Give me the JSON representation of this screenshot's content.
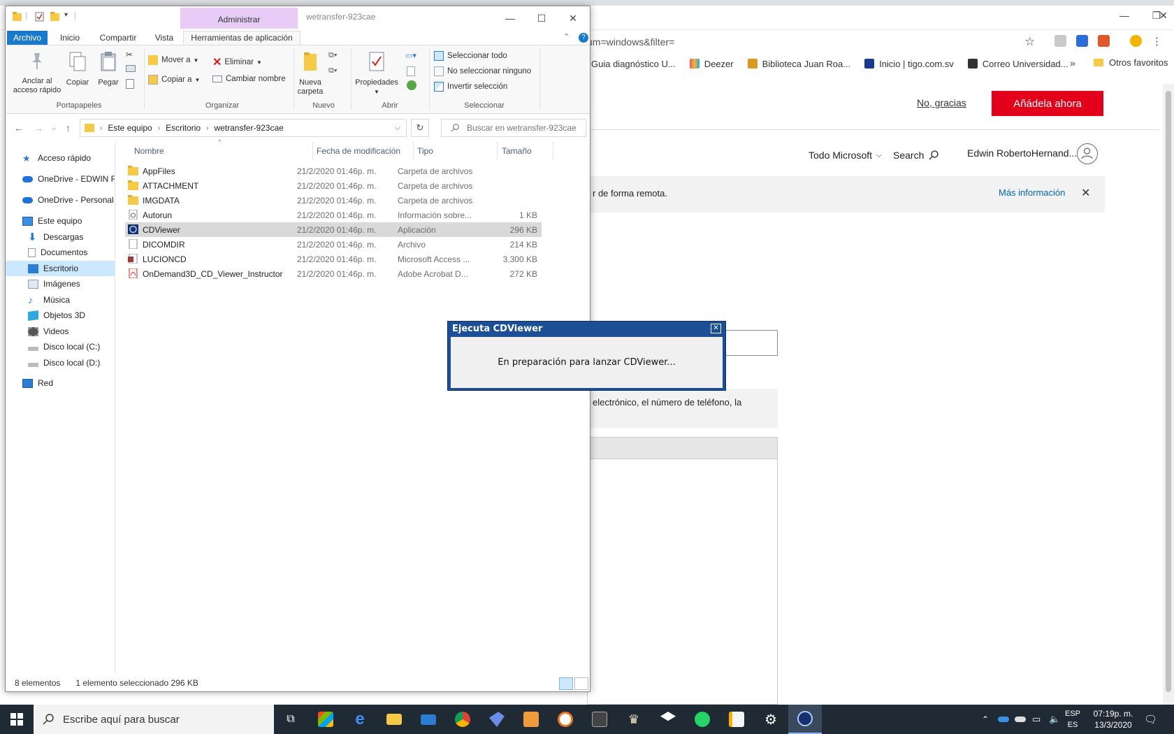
{
  "browser": {
    "url_fragment": "um=windows&filter=",
    "bookmarks": [
      {
        "label": "Guia diagnóstico U...",
        "color": "#2a6ad1"
      },
      {
        "label": "Deezer",
        "color": "#ef5466"
      },
      {
        "label": "Biblioteca Juan Roa...",
        "color": "#d89a1f"
      },
      {
        "label": "Inicio | tigo.com.sv",
        "color": "#1a3a8f"
      },
      {
        "label": "Correo Universidad...",
        "color": "#333333"
      }
    ],
    "bookmarks_more": "»",
    "bookmarks_other": "Otros favoritos",
    "no_thanks": "No, gracias",
    "add_now": "Añádela ahora",
    "ms_nav": "Todo Microsoft",
    "ms_search": "Search",
    "ms_user": "Edwin RobertoHernand...",
    "banner_text": "r de forma remota.",
    "banner_link": "Más información",
    "body_text": "electrónico, el número de teléfono, la"
  },
  "explorer": {
    "window_title": "wetransfer-923cae",
    "contextual_tab": "Administrar",
    "tabs": [
      "Archivo",
      "Inicio",
      "Compartir",
      "Vista",
      "Herramientas de aplicación"
    ],
    "ribbon": {
      "pin": "Anclar al acceso rápido",
      "copy": "Copiar",
      "paste": "Pegar",
      "group_clipboard": "Portapapeles",
      "move_to": "Mover a",
      "copy_to": "Copiar a",
      "delete": "Eliminar",
      "rename": "Cambiar nombre",
      "group_organize": "Organizar",
      "new_folder": "Nueva carpeta",
      "group_new": "Nuevo",
      "properties": "Propiedades",
      "group_open": "Abrir",
      "select_all": "Seleccionar todo",
      "select_none": "No seleccionar ninguno",
      "invert_selection": "Invertir selección",
      "group_select": "Seleccionar"
    },
    "address": [
      "Este equipo",
      "Escritorio",
      "wetransfer-923cae"
    ],
    "search_placeholder": "Buscar en wetransfer-923cae",
    "nav_items": [
      {
        "label": "Acceso rápido",
        "icon": "star-icon",
        "color": "#2b7cd3"
      },
      {
        "label": "OneDrive - EDWIN RC",
        "icon": "cloud-icon",
        "color": "#1e73d6"
      },
      {
        "label": "OneDrive - Personal",
        "icon": "cloud-icon",
        "color": "#1e73d6"
      },
      {
        "label": "Este equipo",
        "icon": "computer-icon",
        "color": "#3a8ee6"
      },
      {
        "label": "Descargas",
        "icon": "download-icon",
        "color": "#2b7cd3"
      },
      {
        "label": "Documentos",
        "icon": "document-icon",
        "color": "#8c9db1"
      },
      {
        "label": "Escritorio",
        "icon": "desktop-icon",
        "color": "#2b7cd3"
      },
      {
        "label": "Imágenes",
        "icon": "pictures-icon",
        "color": "#8c9db1"
      },
      {
        "label": "Música",
        "icon": "music-icon",
        "color": "#2b7cd3"
      },
      {
        "label": "Objetos 3D",
        "icon": "cube-icon",
        "color": "#2fa9e0"
      },
      {
        "label": "Videos",
        "icon": "video-icon",
        "color": "#555555"
      },
      {
        "label": "Disco local (C:)",
        "icon": "drive-icon",
        "color": "#888888"
      },
      {
        "label": "Disco local (D:)",
        "icon": "drive-icon",
        "color": "#888888"
      },
      {
        "label": "Red",
        "icon": "network-icon",
        "color": "#2b7cd3"
      }
    ],
    "columns": [
      "Nombre",
      "Fecha de modificación",
      "Tipo",
      "Tamaño"
    ],
    "files": [
      {
        "name": "AppFiles",
        "date": "21/2/2020 01:46p. m.",
        "type": "Carpeta de archivos",
        "size": "",
        "icon": "folder-icon"
      },
      {
        "name": "ATTACHMENT",
        "date": "21/2/2020 01:46p. m.",
        "type": "Carpeta de archivos",
        "size": "",
        "icon": "folder-icon"
      },
      {
        "name": "IMGDATA",
        "date": "21/2/2020 01:46p. m.",
        "type": "Carpeta de archivos",
        "size": "",
        "icon": "folder-icon"
      },
      {
        "name": "Autorun",
        "date": "21/2/2020 01:46p. m.",
        "type": "Información sobre...",
        "size": "1 KB",
        "icon": "settings-file-icon"
      },
      {
        "name": "CDViewer",
        "date": "21/2/2020 01:46p. m.",
        "type": "Aplicación",
        "size": "296 KB",
        "icon": "app-icon"
      },
      {
        "name": "DICOMDIR",
        "date": "21/2/2020 01:46p. m.",
        "type": "Archivo",
        "size": "214 KB",
        "icon": "file-icon"
      },
      {
        "name": "LUCIONCD",
        "date": "21/2/2020 01:46p. m.",
        "type": "Microsoft Access ...",
        "size": "3,300 KB",
        "icon": "access-icon"
      },
      {
        "name": "OnDemand3D_CD_Viewer_Instructor",
        "date": "21/2/2020 01:46p. m.",
        "type": "Adobe Acrobat D...",
        "size": "272 KB",
        "icon": "pdf-icon"
      }
    ],
    "status_count": "8 elementos",
    "status_selected": "1 elemento seleccionado  296 KB"
  },
  "dialog": {
    "title": "Ejecuta CDViewer",
    "message": "En preparación para lanzar CDViewer..."
  },
  "taskbar": {
    "search_placeholder": "Escribe aquí para buscar",
    "lang_top": "ESP",
    "lang_bottom": "ES",
    "time": "07:19p. m.",
    "date": "13/3/2020"
  }
}
